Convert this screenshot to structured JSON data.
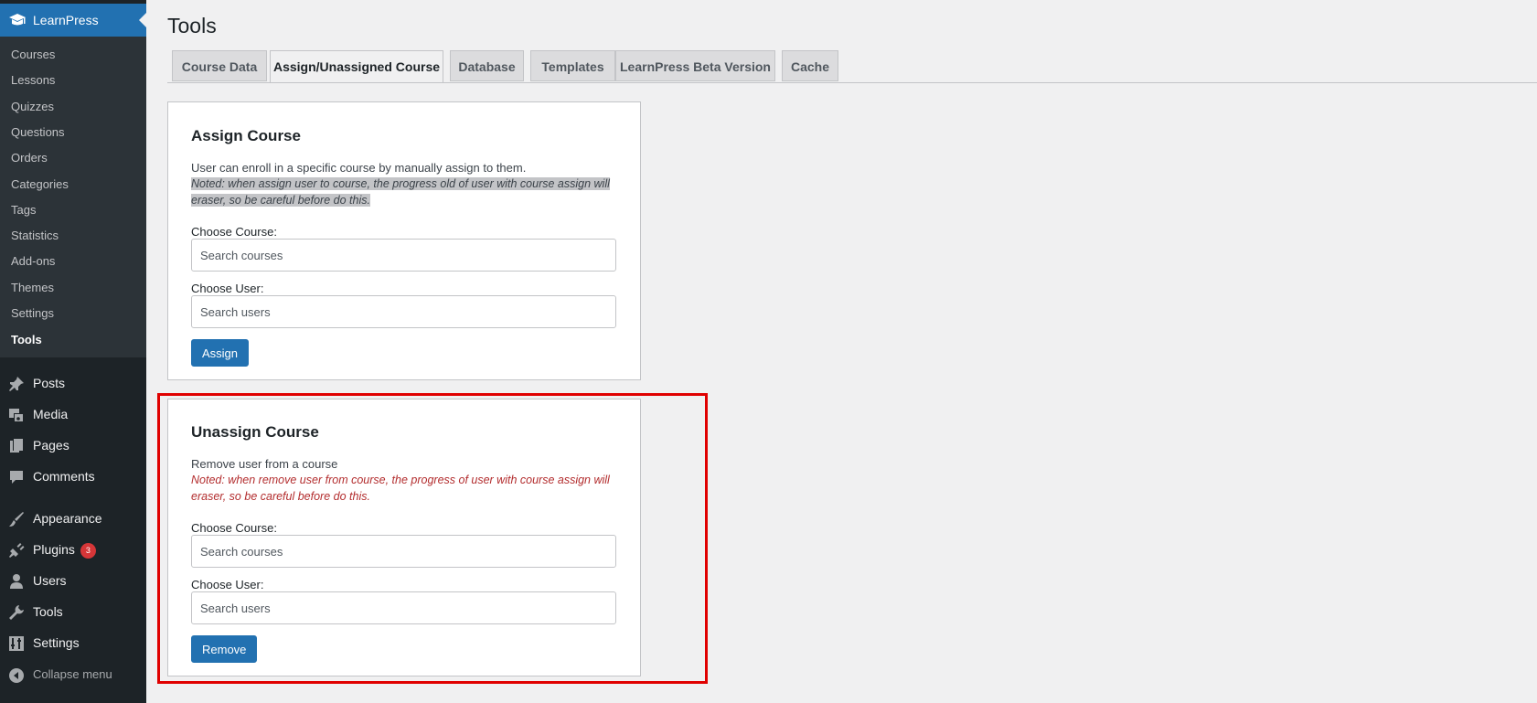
{
  "sidebar": {
    "plugin": {
      "label": "LearnPress"
    },
    "submenu": [
      {
        "label": "Courses"
      },
      {
        "label": "Lessons"
      },
      {
        "label": "Quizzes"
      },
      {
        "label": "Questions"
      },
      {
        "label": "Orders"
      },
      {
        "label": "Categories"
      },
      {
        "label": "Tags"
      },
      {
        "label": "Statistics"
      },
      {
        "label": "Add-ons"
      },
      {
        "label": "Themes"
      },
      {
        "label": "Settings"
      },
      {
        "label": "Tools",
        "active": true
      }
    ],
    "menu": [
      {
        "label": "Posts",
        "icon": "pushpin-icon"
      },
      {
        "label": "Media",
        "icon": "media-icon"
      },
      {
        "label": "Pages",
        "icon": "pages-icon"
      },
      {
        "label": "Comments",
        "icon": "comment-icon"
      },
      {
        "label": "Appearance",
        "icon": "paintbrush-icon"
      },
      {
        "label": "Plugins",
        "icon": "plugin-icon",
        "badge": "3"
      },
      {
        "label": "Users",
        "icon": "user-icon"
      },
      {
        "label": "Tools",
        "icon": "wrench-icon"
      },
      {
        "label": "Settings",
        "icon": "settings-icon"
      }
    ],
    "collapse_label": "Collapse menu"
  },
  "page": {
    "title": "Tools"
  },
  "tabs": [
    {
      "label": "Course Data"
    },
    {
      "label": "Assign/Unassigned Course",
      "active": true
    },
    {
      "label": "Database"
    },
    {
      "label": "Templates"
    },
    {
      "label": "LearnPress Beta Version"
    },
    {
      "label": "Cache"
    }
  ],
  "assign": {
    "title": "Assign Course",
    "description": "User can enroll in a specific course by manually assign to them.",
    "note": "Noted: when assign user to course, the progress old of user with course assign will eraser, so be careful before do this.",
    "course_label": "Choose Course:",
    "course_placeholder": "Search courses",
    "user_label": "Choose User:",
    "user_placeholder": "Search users",
    "button": "Assign"
  },
  "unassign": {
    "title": "Unassign Course",
    "description": "Remove user from a course",
    "note": "Noted: when remove user from course, the progress of user with course assign will eraser, so be careful before do this.",
    "course_label": "Choose Course:",
    "course_placeholder": "Search courses",
    "user_label": "Choose User:",
    "user_placeholder": "Search users",
    "button": "Remove"
  },
  "colors": {
    "sidebar_bg": "#1d2327",
    "submenu_bg": "#2c3338",
    "accent": "#2271b1",
    "warning_red": "#b32d2e",
    "highlight_border": "#e00000"
  }
}
